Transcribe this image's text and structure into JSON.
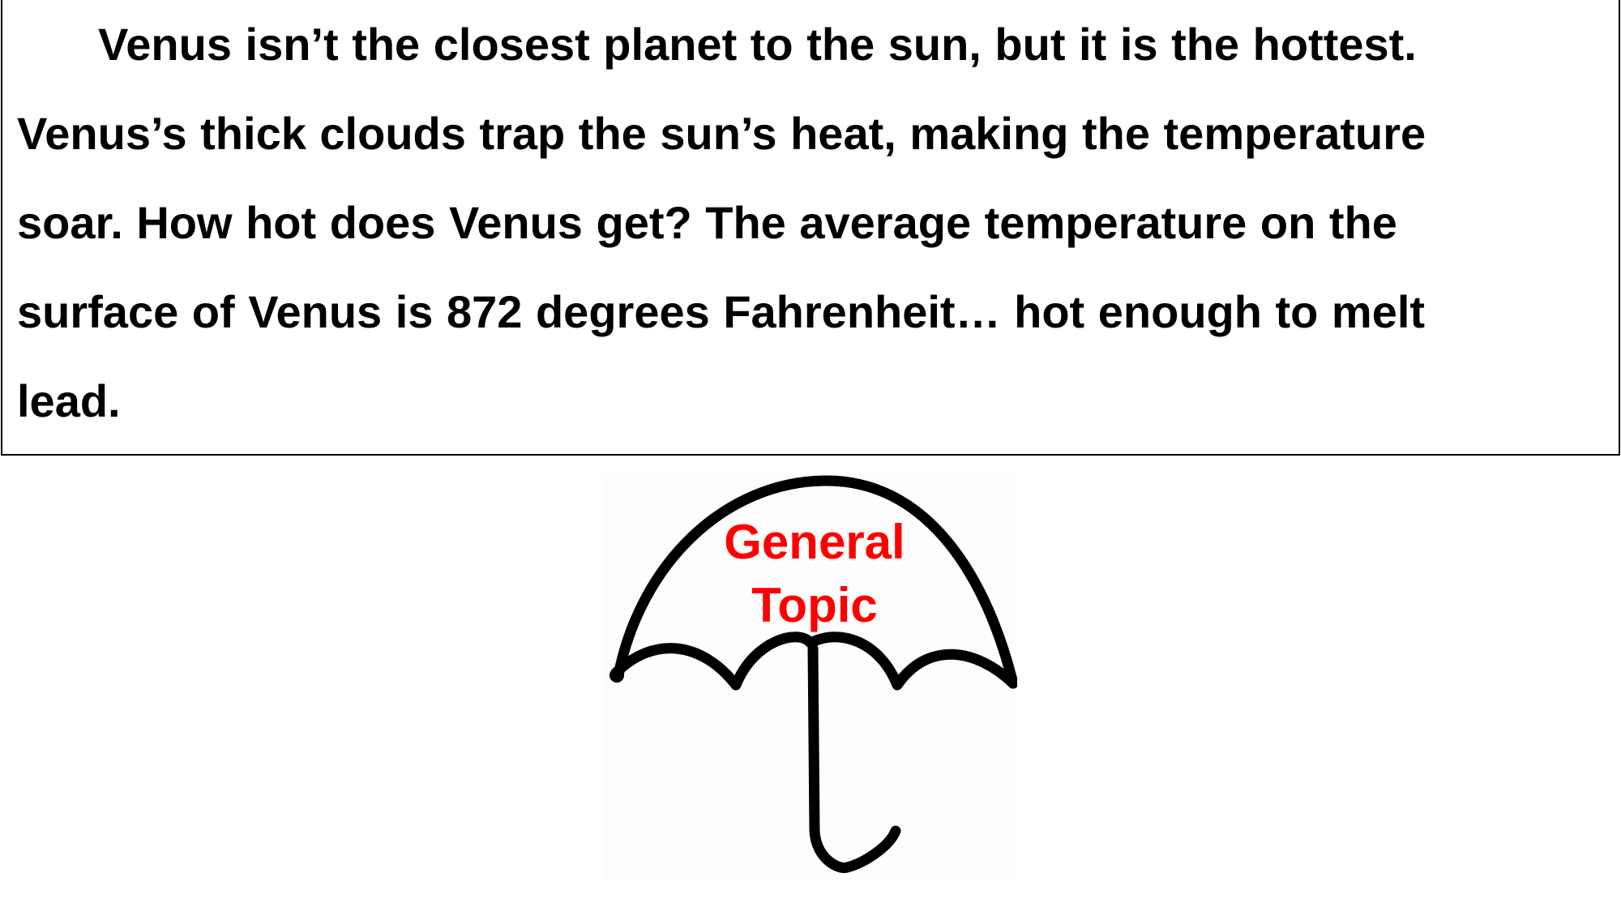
{
  "passage": {
    "lines": [
      "Venus isn’t the closest planet to the sun, but it is the hottest.",
      "Venus’s thick clouds trap the sun’s heat, making the temperature",
      "soar.  How hot does Venus get?  The average temperature on the",
      "surface of Venus is 872 degrees Fahrenheit… hot enough to melt",
      "lead."
    ]
  },
  "umbrella": {
    "label_lines": [
      "General",
      "Topic"
    ],
    "icon": "umbrella-icon",
    "label_color": "#ff0000"
  }
}
